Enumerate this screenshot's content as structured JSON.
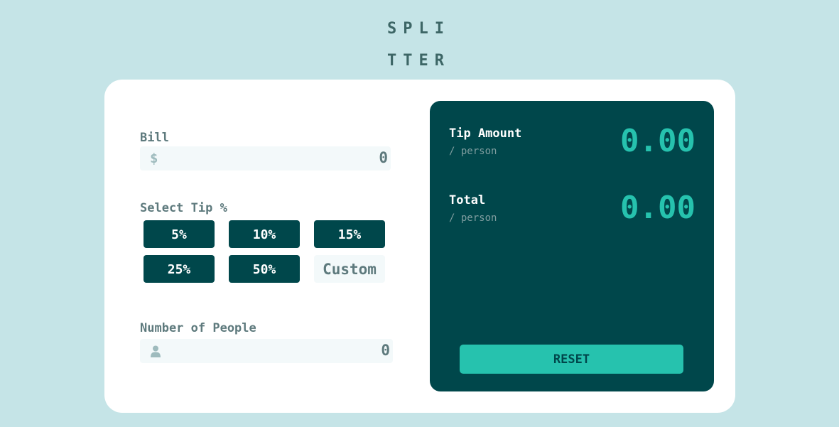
{
  "logo": {
    "line1": "SPLI",
    "line2": "TTER"
  },
  "bill": {
    "label": "Bill",
    "prefix": "$",
    "value": "0"
  },
  "tip": {
    "label": "Select Tip %",
    "options": [
      "5%",
      "10%",
      "15%",
      "25%",
      "50%"
    ],
    "custom_label": "Custom"
  },
  "people": {
    "label": "Number of People",
    "value": "0"
  },
  "results": {
    "tip_amount_label": "Tip Amount",
    "tip_amount_sub": "/ person",
    "tip_amount_value": "0.00",
    "total_label": "Total",
    "total_sub": "/ person",
    "total_value": "0.00",
    "reset_label": "RESET"
  },
  "colors": {
    "background": "#c5e4e7",
    "dark_cyan": "#00474b",
    "accent": "#26c2ae",
    "label_text": "#5e7a7d",
    "input_bg": "#f3f9fa"
  },
  "icons": {
    "people_prefix": "person-icon"
  }
}
